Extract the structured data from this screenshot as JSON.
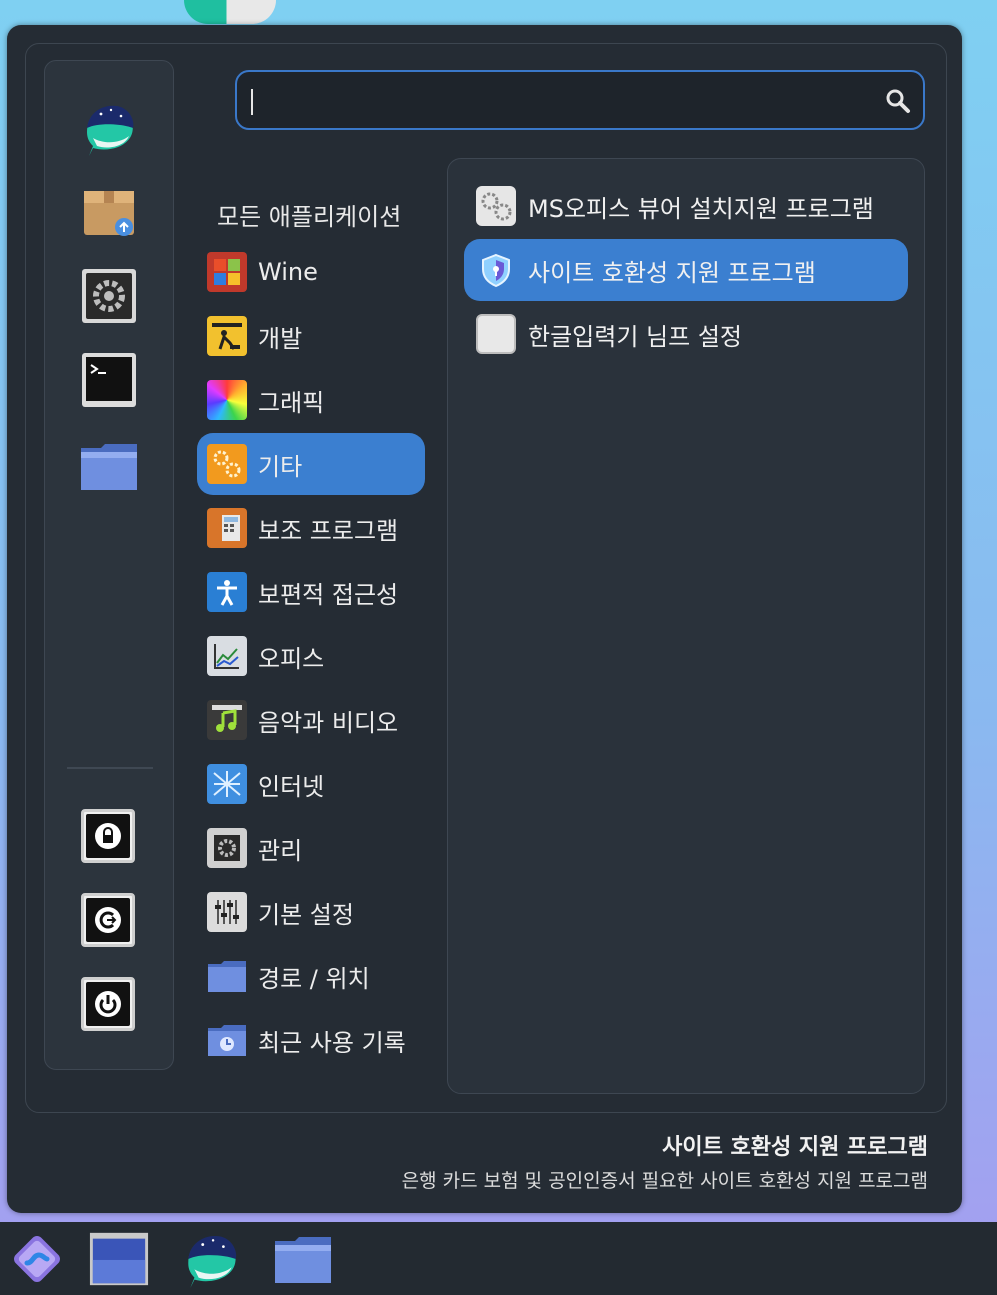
{
  "search": {
    "value": "",
    "placeholder": ""
  },
  "favorites": [
    {
      "name": "whale-browser-icon"
    },
    {
      "name": "package-installer-icon"
    },
    {
      "name": "settings-manager-icon"
    },
    {
      "name": "terminal-icon"
    },
    {
      "name": "folder-icon"
    }
  ],
  "session": [
    {
      "name": "lock-screen-icon"
    },
    {
      "name": "logout-icon"
    },
    {
      "name": "power-icon"
    }
  ],
  "categories": {
    "header": "모든 애플리케이션",
    "items": [
      {
        "label": "Wine",
        "icon": "wine-icon",
        "selected": false
      },
      {
        "label": "개발",
        "icon": "development-icon",
        "selected": false
      },
      {
        "label": "그래픽",
        "icon": "graphics-icon",
        "selected": false
      },
      {
        "label": "기타",
        "icon": "other-icon",
        "selected": true
      },
      {
        "label": "보조 프로그램",
        "icon": "accessories-icon",
        "selected": false
      },
      {
        "label": "보편적 접근성",
        "icon": "accessibility-icon",
        "selected": false
      },
      {
        "label": "오피스",
        "icon": "office-icon",
        "selected": false
      },
      {
        "label": "음악과 비디오",
        "icon": "multimedia-icon",
        "selected": false
      },
      {
        "label": "인터넷",
        "icon": "internet-icon",
        "selected": false
      },
      {
        "label": "관리",
        "icon": "administration-icon",
        "selected": false
      },
      {
        "label": "기본 설정",
        "icon": "preferences-icon",
        "selected": false
      },
      {
        "label": "경로 / 위치",
        "icon": "places-icon",
        "selected": false
      },
      {
        "label": "최근 사용 기록",
        "icon": "recent-icon",
        "selected": false
      }
    ]
  },
  "apps": [
    {
      "label": "MS오피스 뷰어 설치지원 프로그램",
      "icon": "gears-icon",
      "selected": false
    },
    {
      "label": "사이트 호환성 지원 프로그램",
      "icon": "shield-icon",
      "selected": true
    },
    {
      "label": "한글입력기 님프 설정",
      "icon": "nimf-icon",
      "selected": false
    }
  ],
  "description": {
    "title": "사이트 호환성 지원 프로그램",
    "body": "은행 카드 보험 및 공인인증서 필요한 사이트 호환성 지원 프로그램"
  },
  "taskbar": [
    {
      "name": "start-menu-icon"
    },
    {
      "name": "show-desktop-icon"
    },
    {
      "name": "whale-browser-icon"
    },
    {
      "name": "file-manager-icon"
    }
  ],
  "colors": {
    "accent": "#3b7fd0",
    "panel": "#252c34",
    "text": "#ececec"
  }
}
